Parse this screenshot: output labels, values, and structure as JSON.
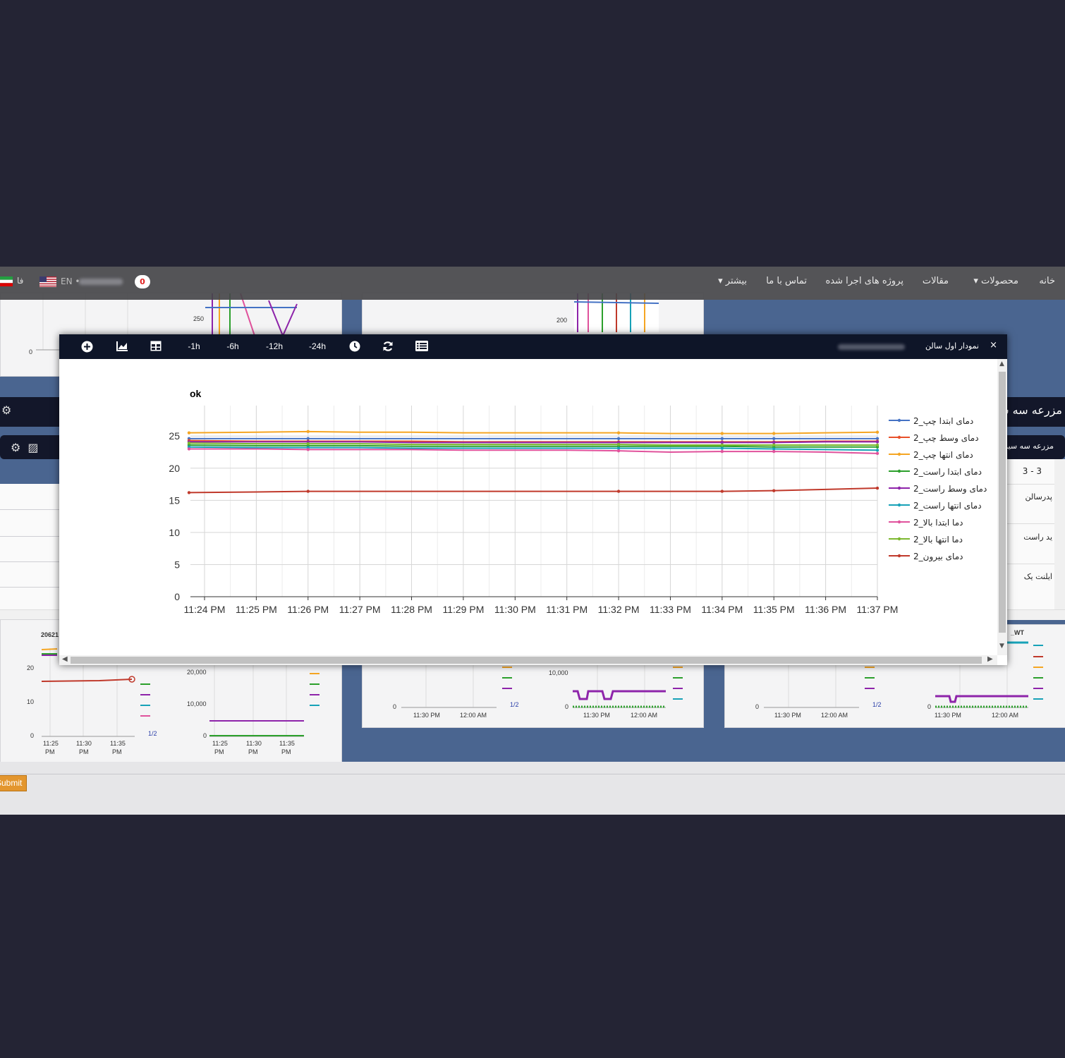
{
  "nav": {
    "items": [
      {
        "label": "خانه",
        "id": "home"
      },
      {
        "label": "محصولات",
        "id": "products",
        "dropdown": true
      },
      {
        "label": "مقالات",
        "id": "articles"
      },
      {
        "label": "پروژه های اجرا شده",
        "id": "projects"
      },
      {
        "label": "تماس با ما",
        "id": "contact"
      },
      {
        "label": "بیشتر",
        "id": "more",
        "dropdown": true
      }
    ],
    "lang_fa": "فا",
    "lang_en": "EN",
    "notification_count": "0"
  },
  "background": {
    "strip_title": "مزرعه سه س",
    "strip2_title": "مزرعه سه سیم",
    "table": {
      "pager": "3 - 3",
      "rows": [
        "پدرسالن",
        "ید راست",
        "ایلنت یک"
      ]
    },
    "mini_chart_labels": {
      "left_ids": "20621",
      "label_wt": "_WT",
      "page_ind": "1/2",
      "y_20": "20",
      "y_10": "10",
      "y_0": "0",
      "y_20000": "20,000",
      "y_10000": "10,000",
      "y_10000b": "10,000",
      "y_250": "250",
      "y_200": "200",
      "t1125": "11:25",
      "t1130": "11:30",
      "t1135": "11:35",
      "pm": "PM",
      "t1130pm": "11:30 PM",
      "t1200am": "12:00 AM"
    },
    "submit_label": "Submit"
  },
  "modal": {
    "title": "نمودار اول سالن",
    "toolbar": {
      "add": "plus-circle-icon",
      "chart": "area-chart-icon",
      "table": "table-icon",
      "r1": "-1h",
      "r6": "-6h",
      "r12": "-12h",
      "r24": "-24h",
      "clock": "clock-icon",
      "refresh": "refresh-icon",
      "list": "list-icon"
    },
    "close": "×"
  },
  "chart_data": {
    "type": "line",
    "title": "ok",
    "xlabel": "",
    "ylabel": "",
    "ylim": [
      0,
      27
    ],
    "yticks": [
      0,
      5,
      10,
      15,
      20,
      25
    ],
    "x": [
      "11:24 PM",
      "11:25 PM",
      "11:26 PM",
      "11:27 PM",
      "11:28 PM",
      "11:29 PM",
      "11:30 PM",
      "11:31 PM",
      "11:32 PM",
      "11:33 PM",
      "11:34 PM",
      "11:35 PM",
      "11:36 PM",
      "11:37 PM"
    ],
    "grid": true,
    "legend": "right",
    "series": [
      {
        "name": "دمای ابتدا چپ_2",
        "color": "#4472c4",
        "values": [
          24.6,
          24.6,
          24.6,
          24.6,
          24.6,
          24.6,
          24.6,
          24.6,
          24.6,
          24.6,
          24.6,
          24.6,
          24.6,
          24.6
        ]
      },
      {
        "name": "دمای وسط چپ_2",
        "color": "#e8502a",
        "values": [
          24.3,
          24.2,
          24.2,
          24.2,
          24.2,
          24.1,
          24.1,
          24.1,
          24.1,
          24.1,
          24.1,
          24.1,
          24.2,
          24.2
        ]
      },
      {
        "name": "دمای انتها چپ_2",
        "color": "#f5a623",
        "values": [
          25.5,
          25.6,
          25.7,
          25.6,
          25.6,
          25.5,
          25.5,
          25.5,
          25.5,
          25.4,
          25.4,
          25.4,
          25.5,
          25.6
        ]
      },
      {
        "name": "دمای ابتدا راست_2",
        "color": "#2ca02c",
        "values": [
          23.6,
          23.5,
          23.5,
          23.5,
          23.4,
          23.4,
          23.4,
          23.4,
          23.4,
          23.4,
          23.4,
          23.3,
          23.3,
          23.3
        ]
      },
      {
        "name": "دمای وسط راست_2",
        "color": "#8e24aa",
        "values": [
          24.1,
          24.1,
          24.1,
          24.1,
          24.0,
          24.0,
          24.0,
          24.0,
          24.0,
          24.0,
          24.0,
          24.0,
          24.1,
          24.1
        ]
      },
      {
        "name": "دمای انتها راست_2",
        "color": "#17a2b8",
        "values": [
          23.3,
          23.2,
          23.2,
          23.2,
          23.1,
          23.1,
          23.1,
          23.1,
          23.1,
          23.1,
          23.1,
          23.0,
          22.9,
          22.8
        ]
      },
      {
        "name": "دما ابتدا بالا_2",
        "color": "#e0529c",
        "values": [
          23.0,
          23.0,
          22.9,
          22.9,
          22.9,
          22.8,
          22.8,
          22.8,
          22.7,
          22.5,
          22.6,
          22.6,
          22.5,
          22.3
        ]
      },
      {
        "name": "دما انتها بالا_2",
        "color": "#7cb82f",
        "values": [
          23.9,
          23.8,
          23.8,
          23.8,
          23.7,
          23.7,
          23.7,
          23.7,
          23.7,
          23.6,
          23.6,
          23.6,
          23.6,
          23.6
        ]
      },
      {
        "name": "دمای بیرون_2",
        "color": "#c0392b",
        "values": [
          16.2,
          16.3,
          16.4,
          16.4,
          16.4,
          16.4,
          16.4,
          16.4,
          16.4,
          16.4,
          16.4,
          16.5,
          16.7,
          16.9
        ]
      }
    ]
  }
}
